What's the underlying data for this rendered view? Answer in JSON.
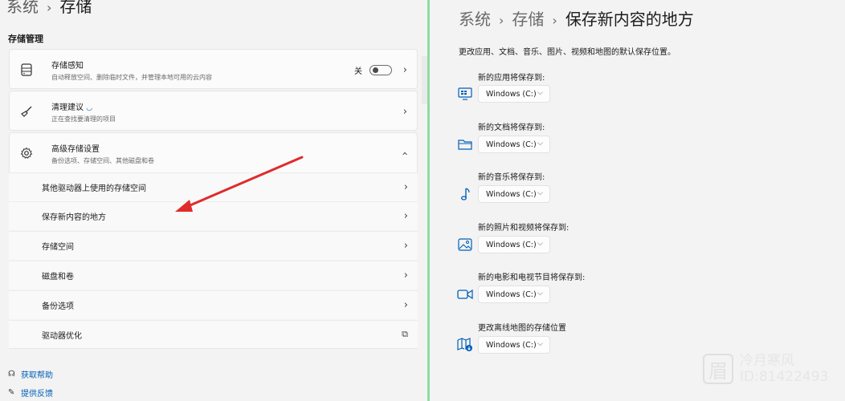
{
  "left": {
    "breadcrumb": {
      "root": "系统",
      "current": "存储"
    },
    "section_title": "存储管理",
    "storage_sense": {
      "title": "存储感知",
      "desc": "自动释放空间、删除临时文件，并管理本地可用的云内容",
      "toggle_label": "关",
      "toggle_on": false
    },
    "cleanup": {
      "title": "清理建议",
      "desc": "正在查找要清理的项目"
    },
    "advanced": {
      "title": "高级存储设置",
      "desc": "备份选项、存储空间、其他磁盘和卷"
    },
    "sub_items": [
      {
        "label": "其他驱动器上使用的存储空间"
      },
      {
        "label": "保存新内容的地方"
      },
      {
        "label": "存储空间"
      },
      {
        "label": "磁盘和卷"
      },
      {
        "label": "备份选项"
      },
      {
        "label": "驱动器优化"
      }
    ],
    "help": {
      "get_help": "获取帮助",
      "feedback": "提供反馈"
    }
  },
  "right": {
    "breadcrumb": {
      "root": "系统",
      "mid": "存储",
      "current": "保存新内容的地方"
    },
    "description": "更改应用、文档、音乐、图片、视频和地图的默认保存位置。",
    "groups": [
      {
        "label": "新的应用将保存到:",
        "value": "Windows (C:)",
        "icon": "apps-icon"
      },
      {
        "label": "新的文档将保存到:",
        "value": "Windows (C:)",
        "icon": "folder-icon"
      },
      {
        "label": "新的音乐将保存到:",
        "value": "Windows (C:)",
        "icon": "music-note-icon"
      },
      {
        "label": "新的照片和视频将保存到:",
        "value": "Windows (C:)",
        "icon": "picture-icon"
      },
      {
        "label": "新的电影和电视节目将保存到:",
        "value": "Windows (C:)",
        "icon": "video-camera-icon"
      },
      {
        "label": "更改离线地图的存储位置",
        "value": "Windows (C:)",
        "icon": "map-download-icon"
      }
    ]
  },
  "watermark": {
    "line1": "冷月寒风",
    "line2": "ID:81422493",
    "logo_glyph": "眉"
  },
  "colors": {
    "accent": "#005fb8",
    "annotation_arrow": "#e02b2b",
    "window_border": "#8fdca3"
  }
}
